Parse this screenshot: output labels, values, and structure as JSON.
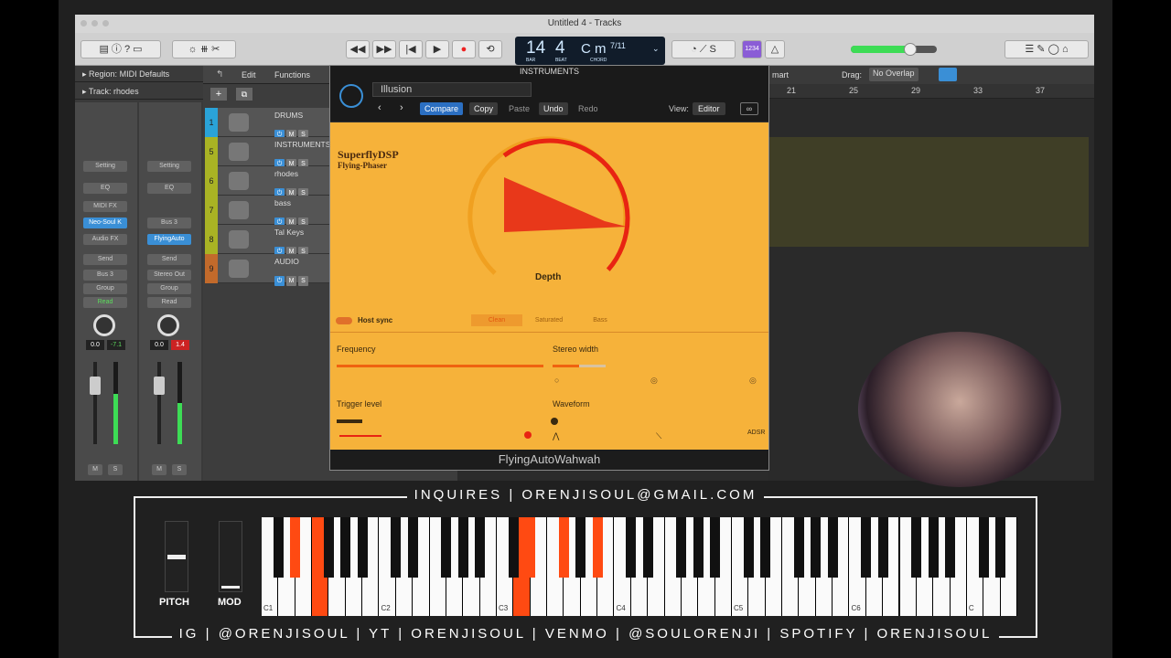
{
  "window": {
    "title": "Untitled 4 - Tracks"
  },
  "lcd": {
    "bar": "14",
    "beat": "4",
    "bar_label": "BAR",
    "beat_label": "BEAT",
    "chord": "C m",
    "chord_ext": "7/11",
    "chord_label": "CHORD"
  },
  "toolbar": {
    "count_in": "1234"
  },
  "inspector": {
    "region_label": "Region:",
    "region_value": "MIDI Defaults",
    "track_label": "Track:",
    "track_value": "rhodes"
  },
  "strip1": {
    "setting": "Setting",
    "eq": "EQ",
    "midifx": "MIDI FX",
    "instrument": "Neo-Soul K",
    "audiofx": "Audio FX",
    "send": "Send",
    "output": "Bus 3",
    "group": "Group",
    "automation": "Read",
    "vol": "0.0",
    "peak": "-7.1",
    "m": "M",
    "s": "S"
  },
  "strip2": {
    "setting": "Setting",
    "eq": "EQ",
    "input": "Bus 3",
    "plugin": "FlyingAuto",
    "send": "Send",
    "output": "Stereo Out",
    "group": "Group",
    "automation": "Read",
    "vol": "0.0",
    "peak": "1.4",
    "m": "M",
    "s": "S"
  },
  "tracks_header": {
    "edit": "Edit",
    "functions": "Functions"
  },
  "tracks": [
    {
      "num": "1",
      "name": "DRUMS",
      "color": "#2aa3d8"
    },
    {
      "num": "5",
      "name": "INSTRUMENTS",
      "color": "#a9b324"
    },
    {
      "num": "6",
      "name": "rhodes",
      "color": "#a9b324"
    },
    {
      "num": "7",
      "name": "bass",
      "color": "#a9b324"
    },
    {
      "num": "8",
      "name": "Tal Keys",
      "color": "#a9b324"
    },
    {
      "num": "9",
      "name": "AUDIO",
      "color": "#c26a2b"
    }
  ],
  "track_buttons": {
    "m": "M",
    "s": "S"
  },
  "arrange": {
    "snap": "mart",
    "drag_label": "Drag:",
    "drag_value": "No Overlap",
    "bars": [
      "21",
      "25",
      "29",
      "33",
      "37"
    ]
  },
  "plugin": {
    "window_title": "INSTRUMENTS",
    "preset": "Illusion",
    "compare": "Compare",
    "copy": "Copy",
    "paste": "Paste",
    "undo": "Undo",
    "redo": "Redo",
    "view_label": "View:",
    "view_value": "Editor",
    "brand": "SuperflyDSP",
    "product": "Flying-Phaser",
    "depth_label": "Depth",
    "host_sync": "Host sync",
    "modes": [
      "Clean",
      "Saturated",
      "Bass"
    ],
    "frequency": "Frequency",
    "stereo_width": "Stereo width",
    "trigger_level": "Trigger level",
    "waveform": "Waveform",
    "adsr": "ADSR",
    "name": "FlyingAutoWahwah",
    "levels": {
      "depth": 0.62,
      "frequency": 1.0,
      "stereo_width": 0.5
    }
  },
  "keyboard": {
    "top_banner": "INQUIRES | ORENJISOUL@GMAIL.COM",
    "bottom_banner": "IG | @ORENJISOUL | YT | ORENJISOUL | VENMO | @SOULORENJI | SPOTIFY | ORENJISOUL",
    "pitch": "PITCH",
    "mod": "MOD",
    "octaves": [
      "C1",
      "C2",
      "C3",
      "C4",
      "C5",
      "C6",
      "C"
    ],
    "pressed_white": [
      3,
      15
    ],
    "pressed_black": [
      1,
      11,
      12,
      14
    ]
  },
  "colors": {
    "accent": "#ff4a12",
    "plugin_bg": "#f6b23a",
    "power": "#3a8fd6"
  }
}
